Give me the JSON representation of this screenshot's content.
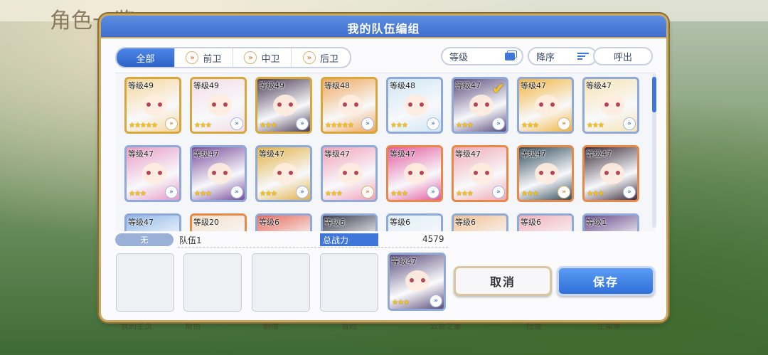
{
  "background": {
    "menu_title": "角色一览",
    "bottom_nav": [
      "我的主页",
      "角色",
      "剧情",
      "冒险",
      "公会之家",
      "扭蛋",
      "主菜单"
    ]
  },
  "dialog": {
    "title": "我的队伍编组",
    "tabs": [
      {
        "label": "全部",
        "active": true,
        "icon": ""
      },
      {
        "label": "前卫",
        "active": false,
        "icon": "role-chevron-icon"
      },
      {
        "label": "中卫",
        "active": false,
        "icon": "role-chevron-icon"
      },
      {
        "label": "后卫",
        "active": false,
        "icon": "role-chevron-icon"
      }
    ],
    "sort_field": "等级",
    "sort_order": "降序",
    "sortie": "呼出",
    "characters": [
      {
        "level": "等级49",
        "stars": "★★★★★",
        "role": "orange",
        "selected": false,
        "bg": "#f6d79a",
        "border": "#d7a73b"
      },
      {
        "level": "等级49",
        "stars": "★★★",
        "role": "blue",
        "selected": false,
        "bg": "#f3dde4",
        "border": "#d7a73b"
      },
      {
        "level": "等级49",
        "stars": "★★★",
        "role": "blue",
        "selected": false,
        "bg": "#4a3a55",
        "border": "#d7a73b"
      },
      {
        "level": "等级48",
        "stars": "★★★★★",
        "role": "blue",
        "selected": false,
        "bg": "#f1a65a",
        "border": "#d7a73b"
      },
      {
        "level": "等级48",
        "stars": "★★★",
        "role": "blue",
        "selected": false,
        "bg": "#cfe6f3",
        "border": "#8fa9d8"
      },
      {
        "level": "等级47",
        "stars": "★★★",
        "role": "blue",
        "selected": true,
        "bg": "#5a4a7a",
        "border": "#8fa9d8"
      },
      {
        "level": "等级47",
        "stars": "★★★",
        "role": "orange",
        "selected": false,
        "bg": "#f4b43c",
        "border": "#8fa9d8"
      },
      {
        "level": "等级47",
        "stars": "★★★",
        "role": "blue",
        "selected": false,
        "bg": "#f7e3b0",
        "border": "#8fa9d8"
      },
      {
        "level": "等级47",
        "stars": "★★★",
        "role": "blue",
        "selected": false,
        "bg": "#e99ac4",
        "border": "#8fa9d8"
      },
      {
        "level": "等级47",
        "stars": "★★★",
        "role": "blue",
        "selected": false,
        "bg": "#7a4a9a",
        "border": "#8fa9d8"
      },
      {
        "level": "等级47",
        "stars": "★★★",
        "role": "blue",
        "selected": false,
        "bg": "#e2b040",
        "border": "#8fa9d8"
      },
      {
        "level": "等级47",
        "stars": "★★★",
        "role": "orange",
        "selected": false,
        "bg": "#f3a0b8",
        "border": "#8fa9d8"
      },
      {
        "level": "等级47",
        "stars": "★★★",
        "role": "blue",
        "selected": false,
        "bg": "#e45aa0",
        "border": "#e8894a"
      },
      {
        "level": "等级47",
        "stars": "★★★",
        "role": "blue",
        "selected": false,
        "bg": "#f0a8b4",
        "border": "#e8894a"
      },
      {
        "level": "等级47",
        "stars": "★★★",
        "role": "orange",
        "selected": false,
        "bg": "#2f4a5a",
        "border": "#e8894a"
      },
      {
        "level": "等级47",
        "stars": "★★★",
        "role": "blue",
        "selected": false,
        "bg": "#3a2a3a",
        "border": "#e8894a"
      },
      {
        "level": "等级47",
        "stars": "",
        "role": "blue",
        "selected": false,
        "bg": "#8fb7e8",
        "border": "#8fa9d8"
      },
      {
        "level": "等级20",
        "stars": "",
        "role": "blue",
        "selected": false,
        "bg": "#f5e0c8",
        "border": "#e8894a"
      },
      {
        "level": "等级6",
        "stars": "",
        "role": "blue",
        "selected": false,
        "bg": "#e86a5a",
        "border": "#8fa9d8"
      },
      {
        "level": "等级6",
        "stars": "",
        "role": "blue",
        "selected": false,
        "bg": "#3a3a4a",
        "border": "#8fa9d8"
      },
      {
        "level": "等级6",
        "stars": "",
        "role": "blue",
        "selected": false,
        "bg": "#dfeef6",
        "border": "#8fa9d8"
      },
      {
        "level": "等级6",
        "stars": "",
        "role": "blue",
        "selected": false,
        "bg": "#f3c090",
        "border": "#8fa9d8"
      },
      {
        "level": "等级6",
        "stars": "",
        "role": "blue",
        "selected": false,
        "bg": "#f2b0b8",
        "border": "#8fa9d8"
      },
      {
        "level": "等级1",
        "stars": "",
        "role": "blue",
        "selected": false,
        "bg": "#6a4a8a",
        "border": "#8fa9d8"
      }
    ],
    "position_label": "无",
    "team_name": "队伍1",
    "power_label": "总战力",
    "power_value": "4579",
    "team_slots": 4,
    "team_member": {
      "level": "等级47",
      "stars": "★★★",
      "role": "blue",
      "bg": "#5a4a7a",
      "border": "#8fa9d8"
    },
    "cancel": "取消",
    "save": "保存"
  }
}
